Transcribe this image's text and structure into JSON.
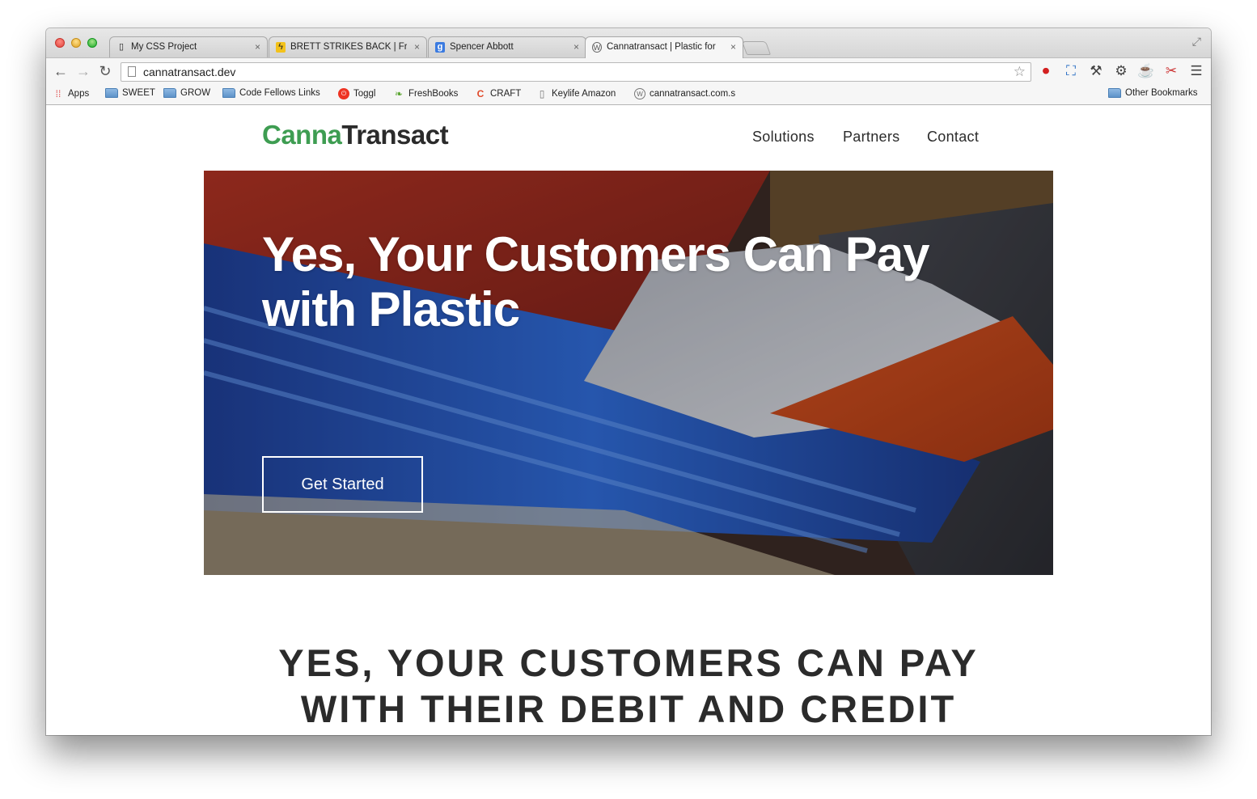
{
  "browser": {
    "tabs": [
      {
        "title": "My CSS Project",
        "icon": "page-icon"
      },
      {
        "title": "BRETT STRIKES BACK | Fre",
        "icon": "lightning-icon"
      },
      {
        "title": "Spencer Abbott",
        "icon": "google-icon"
      },
      {
        "title": "Cannatransact | Plastic for",
        "icon": "wordpress-icon"
      }
    ],
    "close_glyph": "×",
    "url": "cannatransact.dev",
    "bookmarks": [
      {
        "label": "Apps"
      },
      {
        "label": "SWEET"
      },
      {
        "label": "GROW"
      },
      {
        "label": "Code Fellows Links"
      },
      {
        "label": "Toggl"
      },
      {
        "label": "FreshBooks"
      },
      {
        "label": "CRAFT"
      },
      {
        "label": "Keylife Amazon"
      },
      {
        "label": "cannatransact.com.s"
      }
    ],
    "other_bookmarks": "Other Bookmarks"
  },
  "site": {
    "logo_part1": "Canna",
    "logo_part2": "Transact",
    "brand_green": "#3e9d52",
    "nav": [
      "Solutions",
      "Partners",
      "Contact"
    ],
    "hero_title_line1": "Yes, Your Customers Can Pay",
    "hero_title_line2": "with Plastic",
    "cta_label": "Get Started",
    "headline_line1": "YES, YOUR CUSTOMERS CAN PAY",
    "headline_line2": "WITH THEIR DEBIT AND CREDIT"
  }
}
